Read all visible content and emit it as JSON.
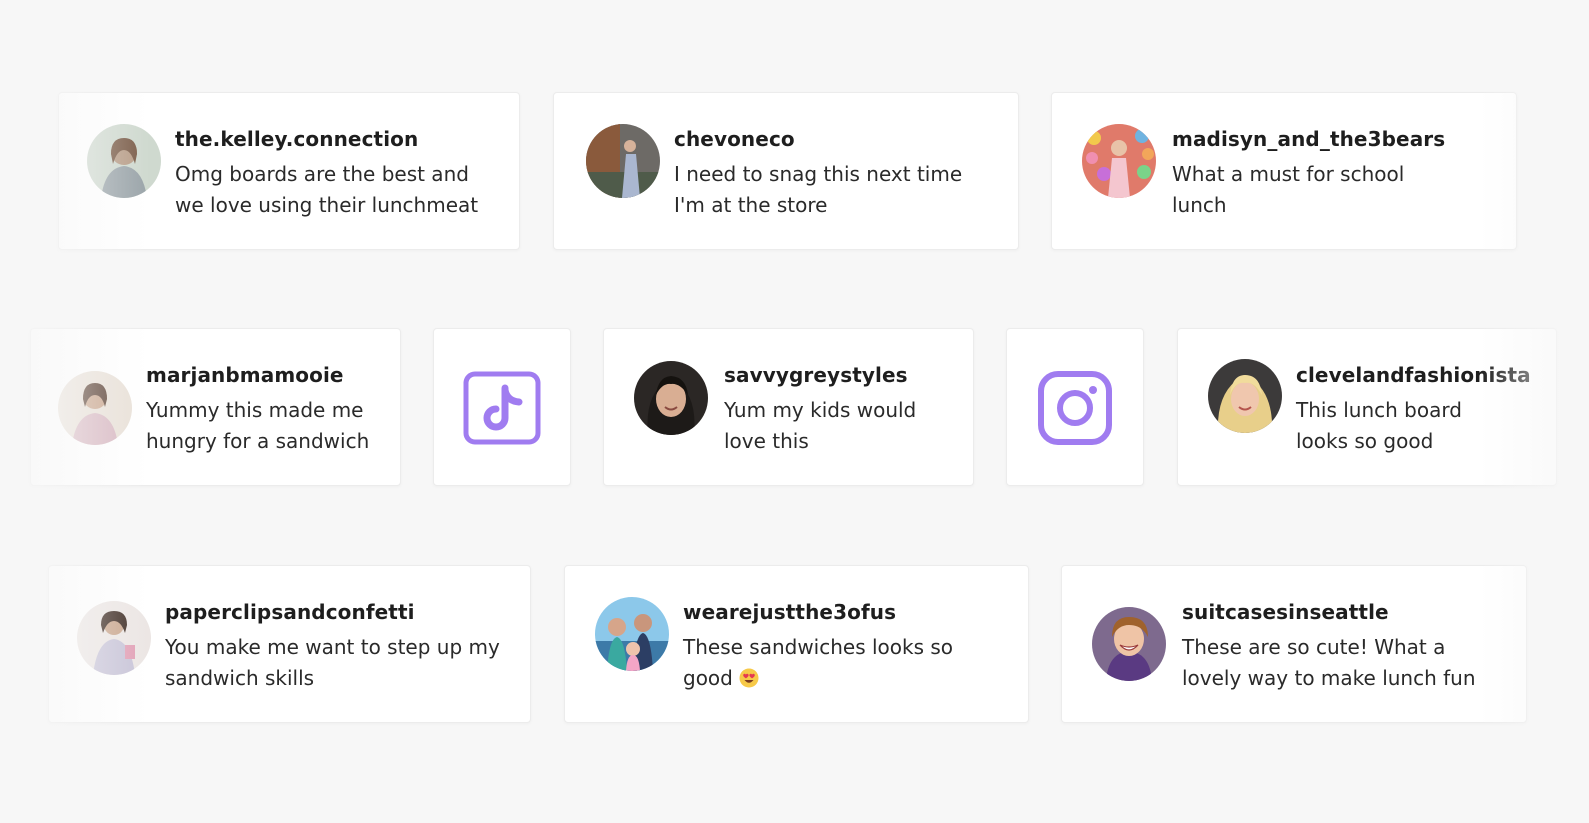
{
  "accent_color": "#a07cf0",
  "rows": [
    {
      "cards": [
        {
          "handle": "the.kelley.connection",
          "comment": "Omg boards are the best and we love using their lunchmeat"
        },
        {
          "handle": "chevoneco",
          "comment": "I need to snag this next time I'm at the store"
        },
        {
          "handle": "madisyn_and_the3bears",
          "comment": "What a must for school lunch"
        }
      ]
    },
    {
      "cards": [
        {
          "handle": "marjanbmamooie",
          "comment": "Yummy this made me hungry for a sandwich"
        },
        {
          "icon": "tiktok-icon"
        },
        {
          "handle": "savvygreystyles",
          "comment": "Yum my kids would love this"
        },
        {
          "icon": "instagram-icon"
        },
        {
          "handle": "clevelandfashionista",
          "comment": "This lunch board looks so good"
        }
      ]
    },
    {
      "cards": [
        {
          "handle": "paperclipsandconfetti",
          "comment": "You make me want to step up my sandwich skills"
        },
        {
          "handle": "wearejustthe3ofus",
          "comment": "These sandwiches looks so good",
          "emoji": "heart-eyes-emoji"
        },
        {
          "handle": "suitcasesinseattle",
          "comment": "These are so cute! What a lovely way to make lunch fun"
        }
      ]
    }
  ]
}
